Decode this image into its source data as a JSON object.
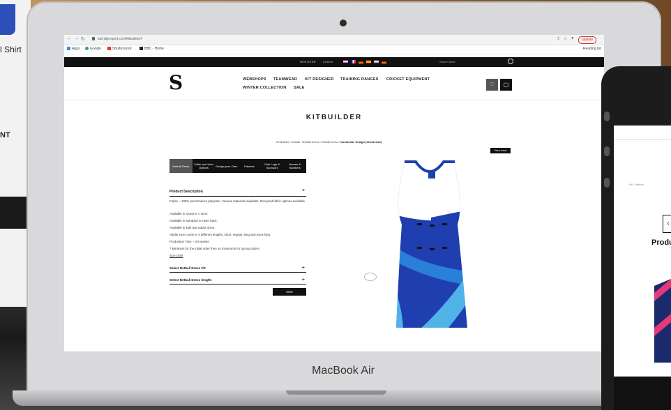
{
  "background": {
    "card_text": "l Shirt",
    "card_partial": "NT"
  },
  "laptop": {
    "label": "MacBook Air"
  },
  "browser": {
    "url": "surridgesport.com/kitbuilder#",
    "update_label": "Update",
    "bookmarks": [
      {
        "label": "Apps",
        "icon": "apps-icon",
        "color": "#4285f4"
      },
      {
        "label": "Google",
        "icon": "google-icon",
        "color": "#34a853"
      },
      {
        "label": "Shutterstock",
        "icon": "shutterstock-icon",
        "color": "#e53935"
      },
      {
        "label": "BBC - Home",
        "icon": "bbc-icon",
        "color": "#222222"
      }
    ],
    "reading_list": "Reading list"
  },
  "site": {
    "topbar": {
      "register": "REGISTER",
      "login": "LOGIN",
      "search_placeholder": "Search store"
    },
    "logo": "S",
    "nav": {
      "row1": [
        "WEBSHOPS",
        "TEAMWEAR",
        "KIT DESIGNER",
        "TRAINING RANGES",
        "CRICKET EQUIPMENT"
      ],
      "row2": [
        "WINTER COLLECTION",
        "SALE"
      ]
    },
    "page_title": "KITBUILDER",
    "breadcrumb": {
      "trail": "Kit Builder / Netball / Netball Dress / Netball Dress / ",
      "current": "Customise Design (Chesterton)"
    },
    "view_back": "View back",
    "tabs": [
      "Netball Dress",
      "Collar and Hem Options",
      "Design your Own",
      "Patches",
      "Club Logo & Sponsors",
      "Names & Numbers"
    ],
    "product_description": {
      "title": "Product Description",
      "lines": [
        "Fabric – 100% performance polyester. Various materials available. Recycled fabric options available.",
        "Available in round or v neck.",
        "Available in standard or raver back.",
        "Available in kids and adults sizes.",
        "Adults sizes come in 4 different lengths, short, regular, long and extra long",
        "Production Time – 3-6 weeks",
        "7 Minimum for the initial order then no minimums for top-up orders."
      ],
      "size_chart": "Size chart"
    },
    "accordions": [
      "Select Netball Dress Fit:",
      "Select Netball Dress length:"
    ],
    "next_label": "Next"
  },
  "phone": {
    "crumb": "Kit / Netball",
    "product_partial": "Produ"
  },
  "colors": {
    "dress_royal": "#1f3fb0",
    "dress_sky": "#4fb3e8",
    "dress_white": "#ffffff",
    "phone_pink": "#e5397a"
  }
}
